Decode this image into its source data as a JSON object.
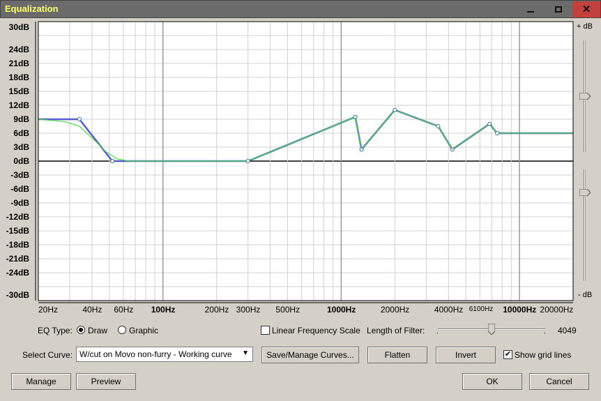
{
  "window": {
    "title": "Equalization",
    "controls": {
      "minimize": "minimize-icon",
      "maximize": "maximize-icon",
      "close": "close-icon"
    }
  },
  "graph": {
    "y_labels": [
      "30dB",
      "24dB",
      "21dB",
      "18dB",
      "15dB",
      "12dB",
      "9dB",
      "6dB",
      "3dB",
      "0dB",
      "-3dB",
      "-6dB",
      "-9dB",
      "-12dB",
      "-15dB",
      "-18dB",
      "-21dB",
      "-24dB",
      "-30dB"
    ],
    "x_labels": [
      "20Hz",
      "40Hz",
      "60Hz",
      "100Hz",
      "200Hz",
      "300Hz",
      "500Hz",
      "1000Hz",
      "2000Hz",
      "4000Hz",
      "6100Hz",
      "10000Hz",
      "20000Hz"
    ],
    "right_top_label": "+ dB",
    "right_bottom_label": "- dB",
    "chart_data": {
      "type": "line",
      "x_scale": "log",
      "xlim": [
        20,
        20000
      ],
      "ylim": [
        -30,
        30
      ],
      "grid": true,
      "series": [
        {
          "color": "#5a5ad6",
          "points": [
            [
              20,
              9
            ],
            [
              34,
              9
            ],
            [
              52,
              0
            ],
            [
              300,
              0
            ],
            [
              1200,
              9.5
            ],
            [
              1300,
              2.5
            ],
            [
              2000,
              11
            ],
            [
              3500,
              7.5
            ],
            [
              4200,
              2.5
            ],
            [
              6800,
              8
            ],
            [
              7500,
              6
            ],
            [
              20000,
              6
            ]
          ]
        },
        {
          "color": "#44dd44",
          "points": [
            [
              20,
              9
            ],
            [
              28,
              8.5
            ],
            [
              34,
              7.5
            ],
            [
              40,
              5
            ],
            [
              48,
              2
            ],
            [
              55,
              0.5
            ],
            [
              65,
              0
            ],
            [
              300,
              0
            ],
            [
              1200,
              9.5
            ],
            [
              1300,
              2.5
            ],
            [
              2000,
              11
            ],
            [
              3500,
              7.5
            ],
            [
              4200,
              2.5
            ],
            [
              6800,
              8
            ],
            [
              7500,
              6
            ],
            [
              20000,
              6
            ]
          ]
        }
      ]
    }
  },
  "controls": {
    "eq_type_label": "EQ Type:",
    "draw_label": "Draw",
    "graphic_label": "Graphic",
    "linear_freq_label": "Linear Frequency Scale",
    "length_label": "Length of Filter:",
    "length_value": "4049",
    "length_fraction": 0.5,
    "select_curve_label": "Select Curve:",
    "curve_value": "W/cut on Movo non-furry - Working curve",
    "save_manage_label": "Save/Manage Curves...",
    "flatten_label": "Flatten",
    "invert_label": "Invert",
    "show_grid_label": "Show grid lines",
    "manage_label": "Manage",
    "preview_label": "Preview",
    "ok_label": "OK",
    "cancel_label": "Cancel"
  }
}
